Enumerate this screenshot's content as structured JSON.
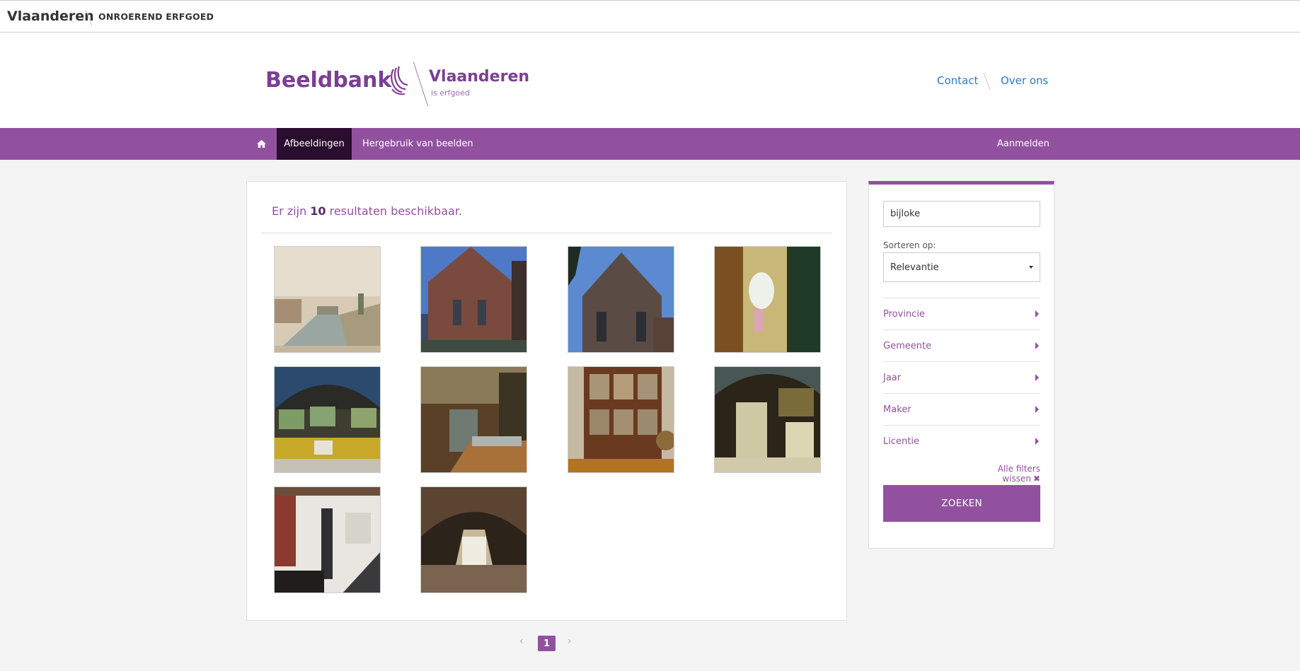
{
  "topbar": {
    "site": "Vlaanderen",
    "agency": "ONROEREND ERFGOED"
  },
  "header": {
    "brand": "Beeldbank",
    "logo_name": "Vlaanderen",
    "logo_tagline": "is erfgoed",
    "links": {
      "contact": "Contact",
      "about": "Over ons"
    }
  },
  "nav": {
    "home_icon": "home-icon",
    "tabs": [
      {
        "label": "Afbeeldingen",
        "active": true
      },
      {
        "label": "Hergebruik van beelden",
        "active": false
      }
    ],
    "login": "Aanmelden"
  },
  "results": {
    "prefix": "Er zijn",
    "count": "10",
    "suffix": "resultaten beschikbaar.",
    "thumbnails": [
      {
        "subject": "painting-canal-view"
      },
      {
        "subject": "gothic-brick-church"
      },
      {
        "subject": "gothic-brick-facade"
      },
      {
        "subject": "wall-urinal-interior"
      },
      {
        "subject": "arched-hall-exhibition"
      },
      {
        "subject": "museum-display-cases"
      },
      {
        "subject": "wooden-cabinet-room"
      },
      {
        "subject": "exhibition-panels-hall"
      },
      {
        "subject": "stairwell-checkered-floor"
      },
      {
        "subject": "long-vaulted-hall"
      }
    ]
  },
  "pagination": {
    "prev": "‹",
    "current": "1",
    "next": "›"
  },
  "filters": {
    "search_value": "bijloke",
    "sort_label": "Sorteren op:",
    "sort_value": "Relevantie",
    "facets": [
      "Provincie",
      "Gemeente",
      "Jaar",
      "Maker",
      "Licentie"
    ],
    "clear_label": "Alle filters wissen",
    "clear_icon": "✖",
    "search_button": "ZOEKEN"
  },
  "colors": {
    "brand": "#92519f",
    "nav_active": "#2b0d2f",
    "link": "#2a7ac7"
  }
}
